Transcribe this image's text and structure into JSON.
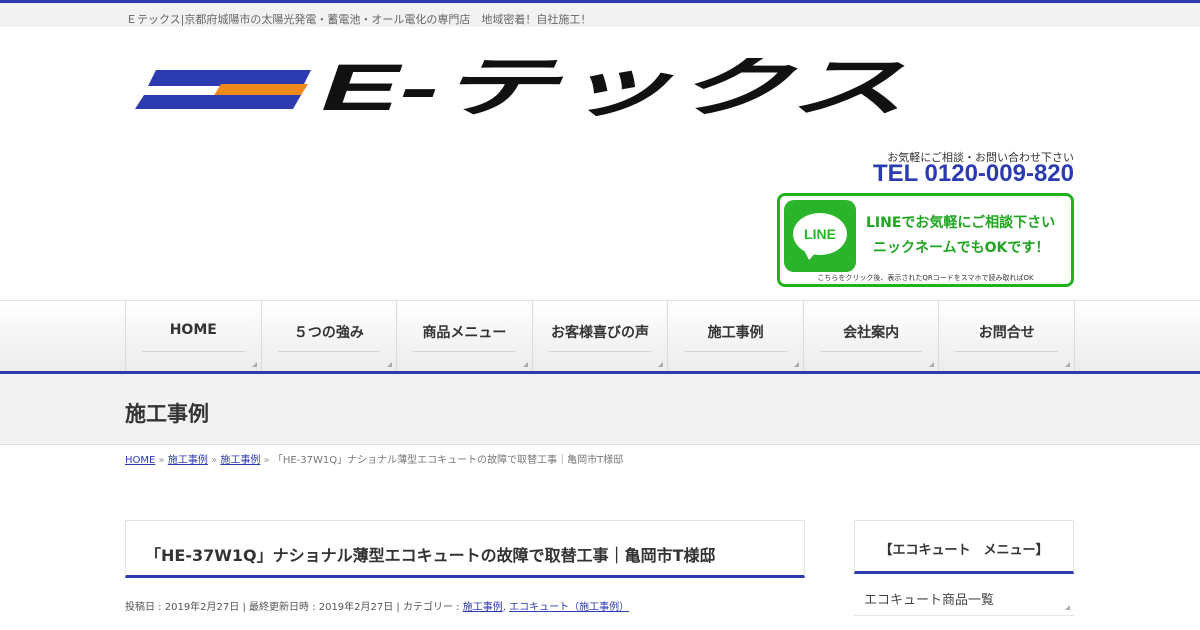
{
  "header": {
    "tagline": "Ｅテックス|京都府城陽市の太陽光発電・蓄電池・オール電化の専門店　地域密着！自社施工！",
    "logo_text": "E-テックス",
    "contact_message": "お気軽にご相談・お問い合わせ下さい",
    "tel": "TEL 0120-009-820",
    "line_banner": {
      "icon_word": "LINE",
      "line1": "LINEでお気軽にご相談下さい",
      "line2": "ニックネームでもOKです！",
      "note": "こちらをクリック後、表示されたQRコードをスマホで読み取ればOK"
    },
    "colors": {
      "brand_blue": "#2c3bb0",
      "brand_orange": "#f08a1c",
      "line_green": "#1fb41f"
    }
  },
  "nav": {
    "items": [
      {
        "label": "HOME"
      },
      {
        "label": "５つの強み"
      },
      {
        "label": "商品メニュー"
      },
      {
        "label": "お客様喜びの声"
      },
      {
        "label": "施工事例"
      },
      {
        "label": "会社案内"
      },
      {
        "label": "お問合せ"
      }
    ]
  },
  "page": {
    "title": "施工事例"
  },
  "breadcrumb": {
    "items": [
      "HOME",
      "施工事例",
      "施工事例"
    ],
    "current": "「HE-37W1Q」ナショナル薄型エコキュートの故障で取替工事｜亀岡市T様邸",
    "separator": "»"
  },
  "post": {
    "title": "「HE-37W1Q」ナショナル薄型エコキュートの故障で取替工事｜亀岡市T様邸",
    "meta_prefix": "投稿日 : 2019年2月27日 | 最終更新日時 : 2019年2月27日 | カテゴリー : ",
    "categories": [
      "施工事例",
      "エコキュート（施工事例）"
    ],
    "category_separator": ", "
  },
  "sidebar": {
    "title": "【エコキュート　メニュー】",
    "items": [
      {
        "label": "エコキュート商品一覧"
      }
    ]
  }
}
